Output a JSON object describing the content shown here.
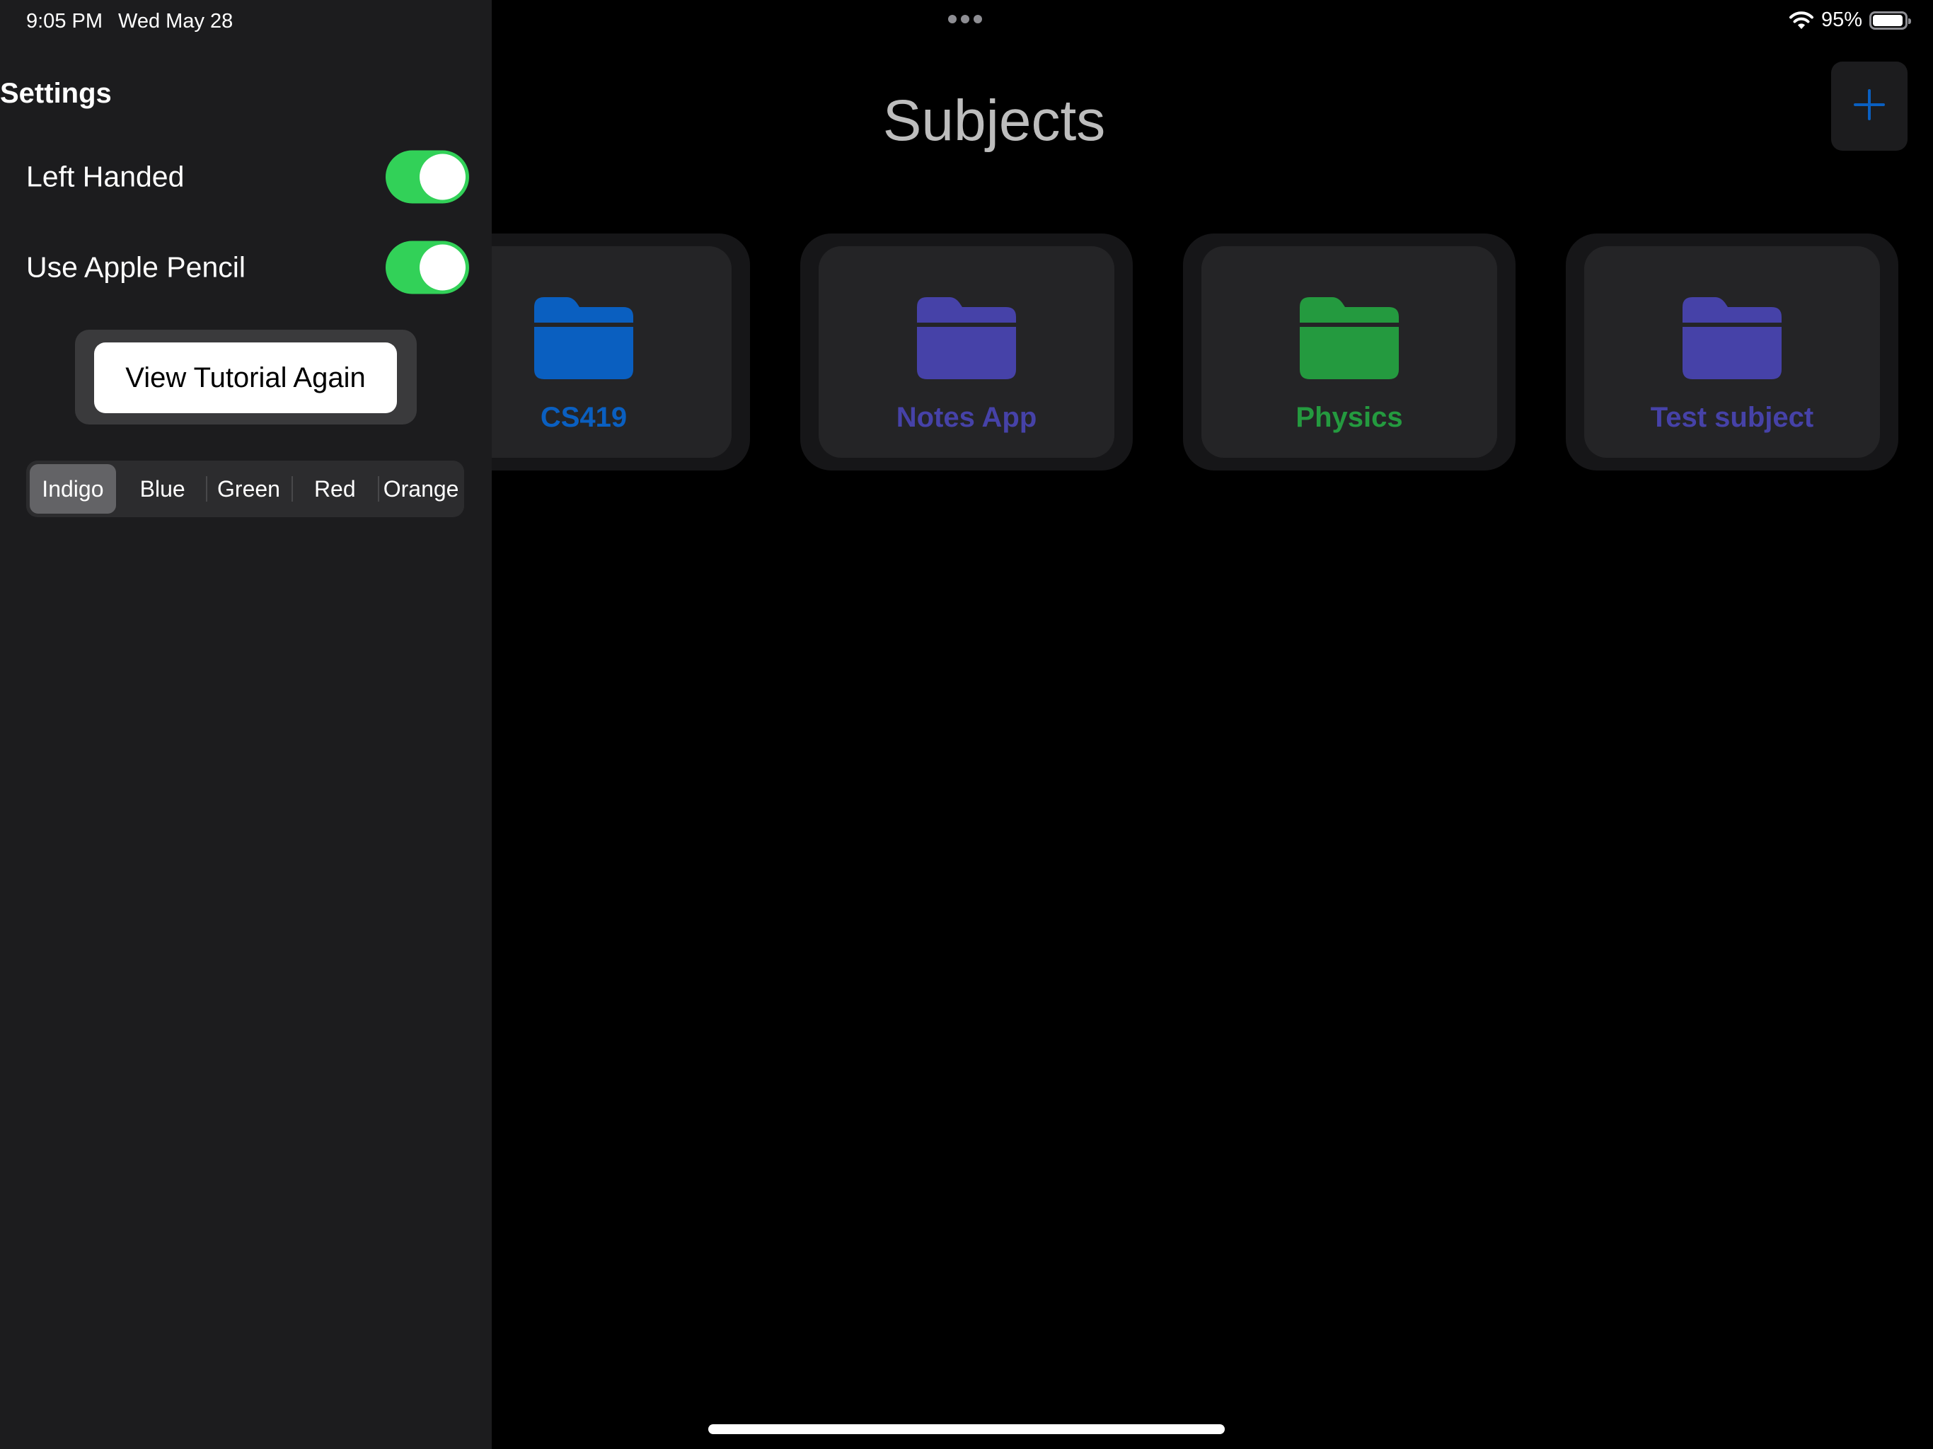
{
  "status_bar": {
    "time": "9:05 PM",
    "date": "Wed May 28",
    "battery": "95%",
    "battery_level": 0.95
  },
  "sidebar": {
    "title": "Settings",
    "left_handed": {
      "label": "Left Handed",
      "on": true
    },
    "apple_pencil": {
      "label": "Use Apple Pencil",
      "on": true
    },
    "tutorial_button": "View Tutorial Again",
    "color_picker": {
      "options": [
        "Indigo",
        "Blue",
        "Green",
        "Red",
        "Orange"
      ],
      "selected": "Indigo"
    }
  },
  "main": {
    "title": "Subjects",
    "add_icon": "plus-icon",
    "subjects": [
      {
        "name": "CS419",
        "color": "#0a5fc0",
        "icon": "folder-icon"
      },
      {
        "name": "Notes App",
        "color": "#4642a8",
        "icon": "folder-icon"
      },
      {
        "name": "Physics",
        "color": "#249a3f",
        "icon": "folder-icon"
      },
      {
        "name": "Test subject",
        "color": "#4642a8",
        "icon": "folder-icon"
      }
    ]
  },
  "colors": {
    "toggle_on": "#32d158",
    "accent_blue": "#0a5fc0",
    "sidebar_bg": "#1c1c1e",
    "main_bg": "#000000"
  }
}
